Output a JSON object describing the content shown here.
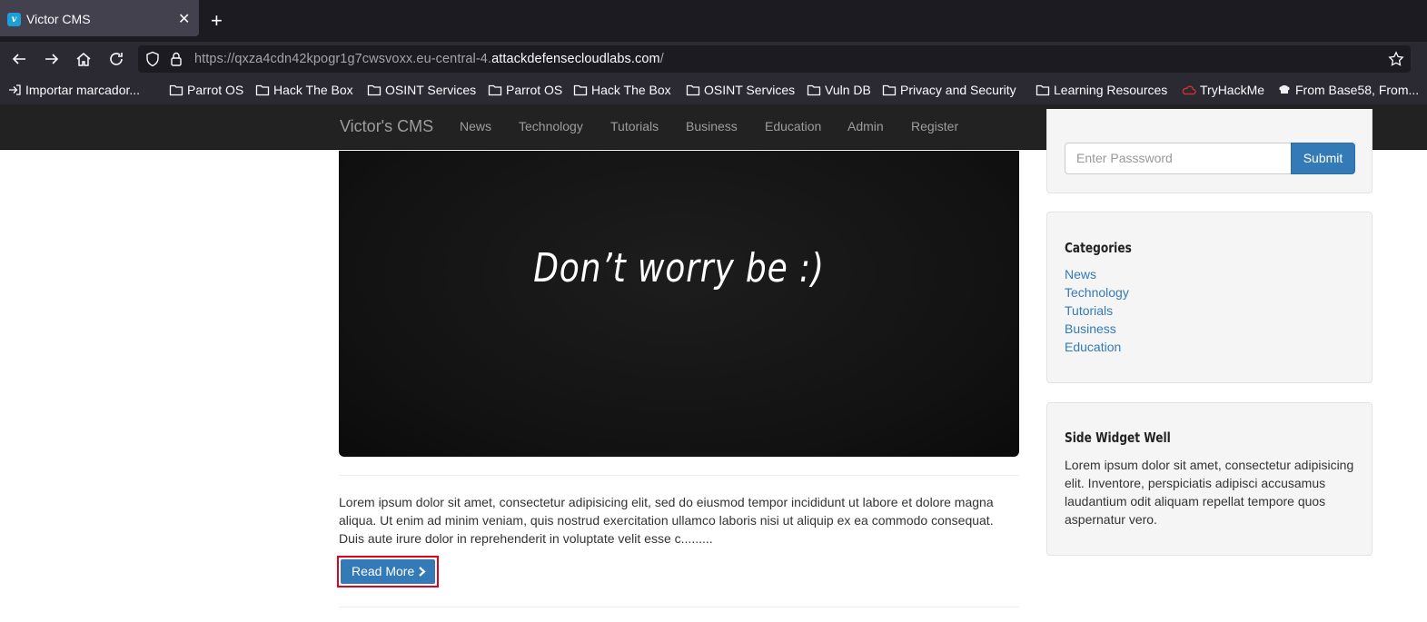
{
  "browser": {
    "tab_title": "Victor CMS",
    "url_prefix": "https://qxza4cdn42kpogr1g7cwsvoxx.eu-central-4.",
    "url_domain": "attackdefensecloudlabs.com",
    "url_suffix": "/",
    "bookmarks": [
      {
        "label": "Importar marcador...",
        "icon": "import-icon"
      },
      {
        "label": "Parrot OS",
        "icon": "folder-icon"
      },
      {
        "label": "Hack The Box",
        "icon": "folder-icon"
      },
      {
        "label": "OSINT Services",
        "icon": "folder-icon"
      },
      {
        "label": "Parrot OS",
        "icon": "folder-icon"
      },
      {
        "label": "Hack The Box",
        "icon": "folder-icon"
      },
      {
        "label": "OSINT Services",
        "icon": "folder-icon"
      },
      {
        "label": "Vuln DB",
        "icon": "folder-icon"
      },
      {
        "label": "Privacy and Security",
        "icon": "folder-icon"
      },
      {
        "label": "Learning Resources",
        "icon": "folder-icon"
      },
      {
        "label": "TryHackMe",
        "icon": "tryhackme-icon"
      },
      {
        "label": "From Base58, From...",
        "icon": "cyberchef-icon"
      }
    ]
  },
  "site": {
    "brand": "Victor's CMS",
    "nav": [
      "News",
      "Technology",
      "Tutorials",
      "Business",
      "Education",
      "Admin",
      "Register"
    ]
  },
  "post": {
    "image_text": "Don’t worry be :)",
    "excerpt": "Lorem ipsum dolor sit amet, consectetur adipisicing elit, sed do eiusmod tempor incididunt ut labore et dolore magna aliqua. Ut enim ad minim veniam, quis nostrud exercitation ullamco laboris nisi ut aliquip ex ea commodo consequat. Duis aute irure dolor in reprehenderit in voluptate velit esse c.........",
    "read_more": "Read More"
  },
  "sidebar": {
    "password_placeholder": "Enter Passsword",
    "submit_label": "Submit",
    "categories_title": "Categories",
    "categories": [
      "News",
      "Technology",
      "Tutorials",
      "Business",
      "Education"
    ],
    "widget_title": "Side Widget Well",
    "widget_text": "Lorem ipsum dolor sit amet, consectetur adipisicing elit. Inventore, perspiciatis adipisci accusamus laudantium odit aliquam repellat tempore quos aspernatur vero."
  },
  "colors": {
    "accent": "#337ab7",
    "highlight": "#e2001a",
    "navbar": "#222222"
  }
}
